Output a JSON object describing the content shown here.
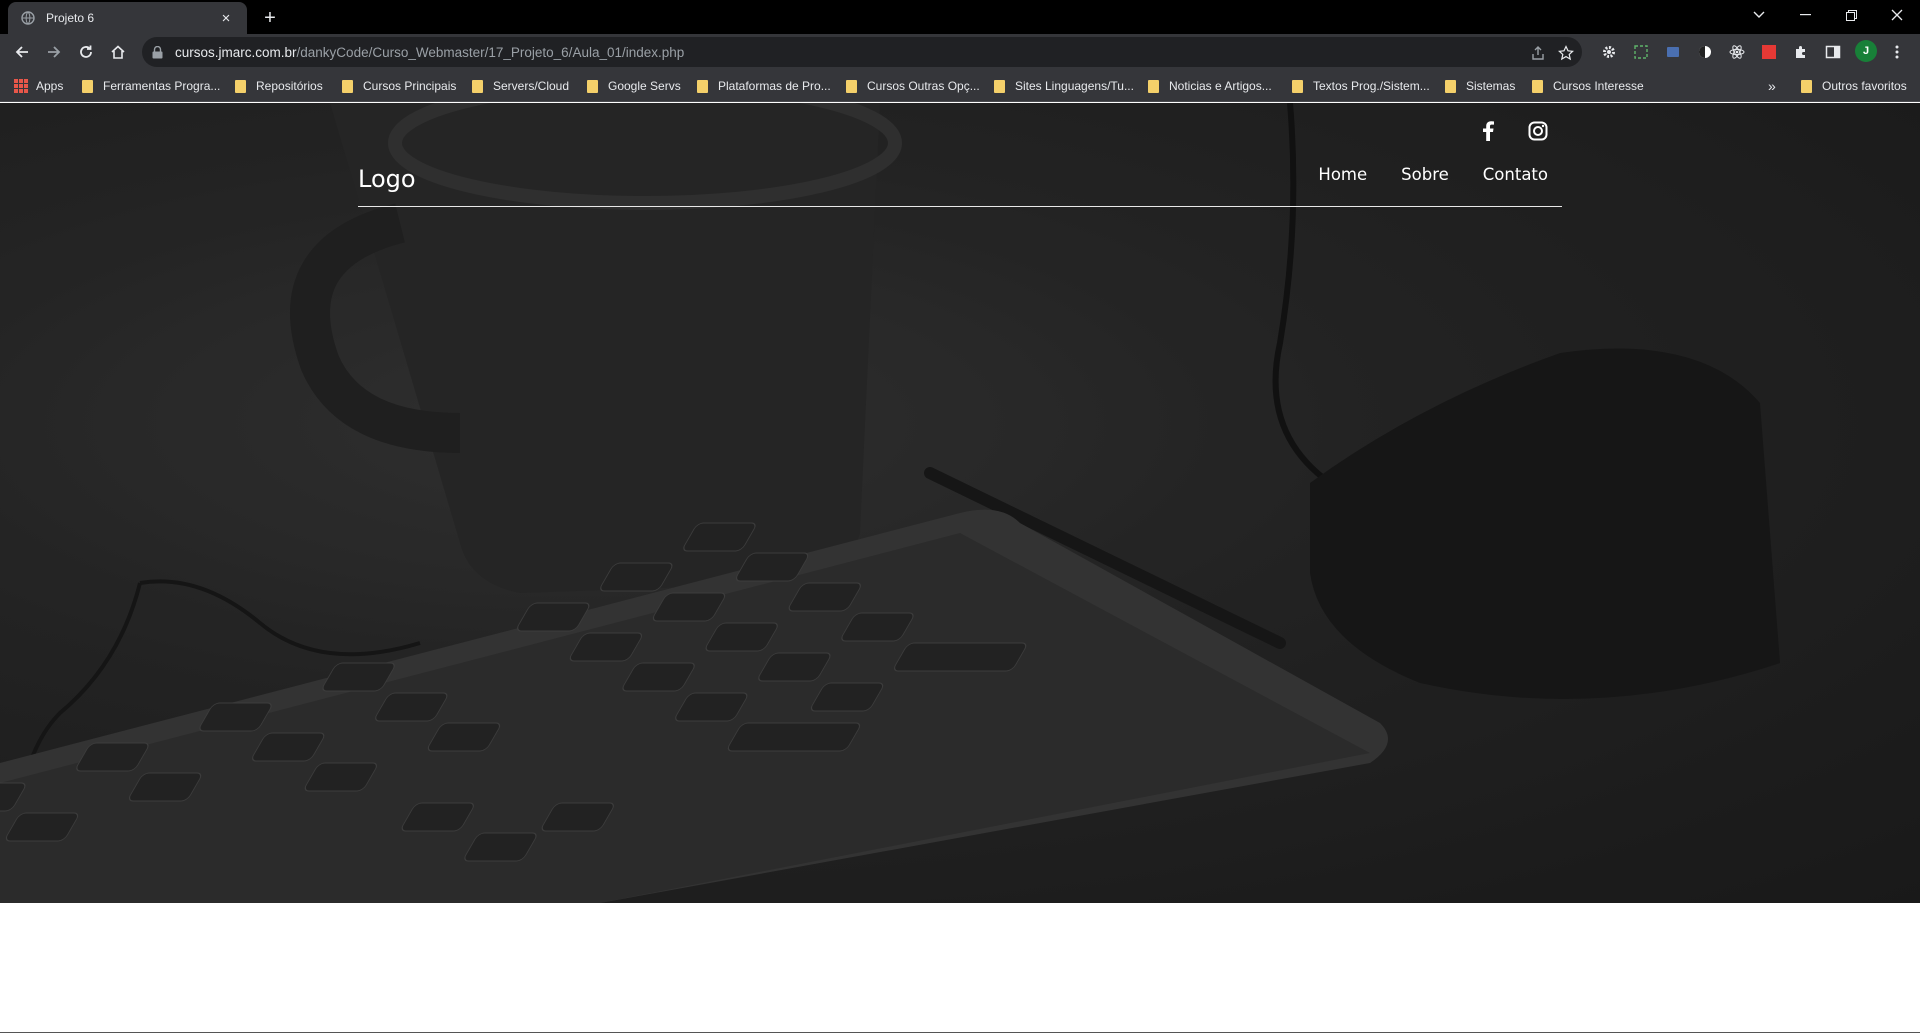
{
  "browser": {
    "tab_title": "Projeto 6",
    "tab_close": "×",
    "new_tab": "+",
    "url_host": "cursos.jmarc.com.br",
    "url_path": "/dankyCode/Curso_Webmaster/17_Projeto_6/Aula_01/index.php",
    "profile_initial": "J",
    "window_controls": [
      "chevron-down-icon",
      "minimize-icon",
      "restore-icon",
      "close-icon"
    ]
  },
  "bookmarks": {
    "apps_label": "Apps",
    "items": [
      "Ferramentas Progra...",
      "Repositórios",
      "Cursos Principais",
      "Servers/Cloud",
      "Google Servs",
      "Plataformas de Pro...",
      "Cursos Outras Opç...",
      "Sites Linguagens/Tu...",
      "Noticias e Artigos...",
      "Textos Prog./Sistem...",
      "Sistemas",
      "Cursos Interesse"
    ],
    "overflow": "»",
    "other": "Outros favoritos"
  },
  "site": {
    "logo": "Logo",
    "menu": [
      "Home",
      "Sobre",
      "Contato"
    ],
    "social": [
      "facebook-icon",
      "instagram-icon"
    ]
  },
  "colors": {
    "chrome_dark": "#000000",
    "chrome_toolbar": "#35363a",
    "omnibox": "#202124",
    "folder": "#f4d06a",
    "profile_green": "#188038",
    "hero_dark": "#2b2b2b"
  }
}
